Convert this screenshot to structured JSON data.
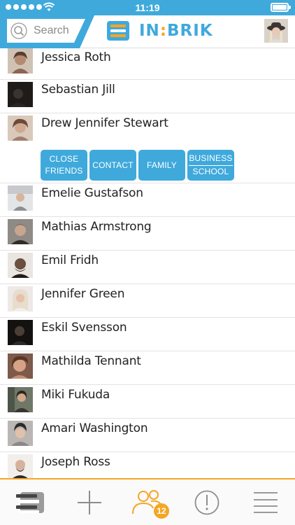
{
  "status_bar": {
    "time": "11:19",
    "signal_icon": "signal-dots-icon",
    "wifi_icon": "wifi-icon",
    "battery_icon": "battery-icon"
  },
  "header": {
    "search_placeholder": "Search",
    "logo_text_primary": "IN",
    "logo_text_colon": ":",
    "logo_text_secondary": "BRIK",
    "brand_color": "#3fa9dc",
    "accent_color": "#f5a623"
  },
  "contacts": [
    {
      "name": "Jessica Roth",
      "avatar_color": "#b58a72"
    },
    {
      "name": "Sebastian Jill",
      "avatar_color": "#3a332e"
    },
    {
      "name": "Drew Jennifer Stewart",
      "avatar_color": "#a17d6d",
      "expanded": true,
      "tags": [
        {
          "line1": "CLOSE",
          "line2": "FRIENDS"
        },
        {
          "line1": "CONTACT",
          "line2": ""
        },
        {
          "line1": "FAMILY",
          "line2": ""
        },
        {
          "line1": "BUSINESS",
          "line2": "SCHOOL"
        }
      ]
    },
    {
      "name": "Emelie Gustafson",
      "avatar_color": "#c7c9cc"
    },
    {
      "name": "Mathias Armstrong",
      "avatar_color": "#5a5753"
    },
    {
      "name": "Emil Fridh",
      "avatar_color": "#6b4f3f"
    },
    {
      "name": "Jennifer Green",
      "avatar_color": "#d6d0cc"
    },
    {
      "name": "Eskil Svensson",
      "avatar_color": "#2d2a28"
    },
    {
      "name": "Mathilda Tennant",
      "avatar_color": "#c48f74"
    },
    {
      "name": "Miki Fukuda",
      "avatar_color": "#4c5548"
    },
    {
      "name": "Amari Washington",
      "avatar_color": "#8b8887"
    },
    {
      "name": "Joseph Ross",
      "avatar_color": "#d9d4cf"
    }
  ],
  "tab_bar": {
    "tabs": [
      {
        "icon": "stack-icon"
      },
      {
        "icon": "plus-icon"
      },
      {
        "icon": "contacts-icon",
        "badge": "12",
        "active": true
      },
      {
        "icon": "alert-icon"
      },
      {
        "icon": "menu-icon"
      }
    ]
  }
}
